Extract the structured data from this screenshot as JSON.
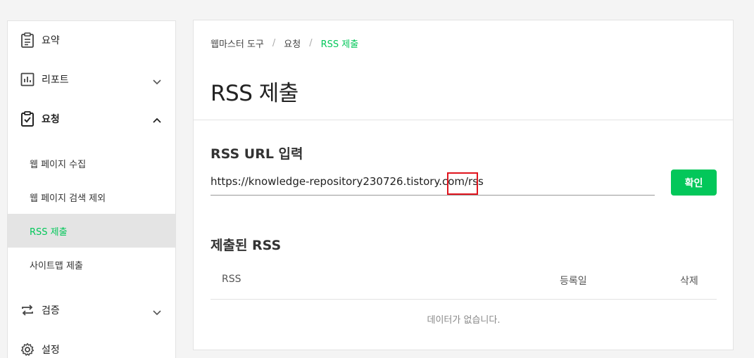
{
  "sidebar": {
    "items": [
      {
        "label": "요약",
        "icon": "clipboard-list-icon"
      },
      {
        "label": "리포트",
        "icon": "bar-chart-icon"
      },
      {
        "label": "요청",
        "icon": "clipboard-check-icon"
      },
      {
        "label": "검증",
        "icon": "repeat-icon"
      },
      {
        "label": "설정",
        "icon": "gear-icon"
      }
    ],
    "sub_items": [
      {
        "label": "웹 페이지 수집"
      },
      {
        "label": "웹 페이지 검색 제외"
      },
      {
        "label": "RSS 제출",
        "active": true
      },
      {
        "label": "사이트맵 제출"
      }
    ]
  },
  "breadcrumb": {
    "items": [
      "웹마스터 도구",
      "요청",
      "RSS 제출"
    ],
    "separator": "/"
  },
  "page_title": "RSS 제출",
  "rss_input": {
    "section_title": "RSS URL 입력",
    "value": "https://knowledge-repository230726.tistory.com/rss",
    "button_label": "확인"
  },
  "submitted": {
    "section_title": "제출된 RSS",
    "columns": [
      "RSS",
      "등록일",
      "삭제"
    ],
    "empty_message": "데이터가 없습니다."
  },
  "colors": {
    "accent": "#03c75a",
    "highlight": "#e0141e",
    "active_bg": "#e4e4e4"
  }
}
